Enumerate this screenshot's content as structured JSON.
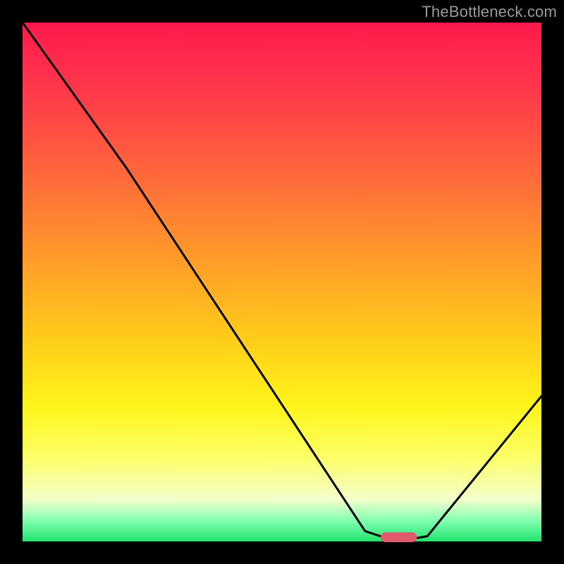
{
  "watermark": "TheBottleneck.com",
  "chart_data": {
    "type": "line",
    "title": "",
    "xlabel": "",
    "ylabel": "",
    "xlim": [
      0,
      100
    ],
    "ylim": [
      0,
      100
    ],
    "x": [
      0,
      20,
      66,
      72,
      78,
      100
    ],
    "values": [
      100,
      72,
      2,
      0,
      1,
      28
    ],
    "marker": {
      "x_start": 69,
      "x_end": 76,
      "y": 0.8,
      "color": "#e05a6a"
    },
    "background_gradient": {
      "stops": [
        {
          "pct": 0,
          "color": "#ff1a4d"
        },
        {
          "pct": 14,
          "color": "#ff3a4a"
        },
        {
          "pct": 30,
          "color": "#ff6a3a"
        },
        {
          "pct": 45,
          "color": "#ff9a2a"
        },
        {
          "pct": 60,
          "color": "#ffc91a"
        },
        {
          "pct": 74,
          "color": "#fff51a"
        },
        {
          "pct": 84,
          "color": "#fcff6a"
        },
        {
          "pct": 92,
          "color": "#f3ffcc"
        },
        {
          "pct": 96,
          "color": "#80ffb0"
        },
        {
          "pct": 100,
          "color": "#22e36e"
        }
      ]
    }
  }
}
